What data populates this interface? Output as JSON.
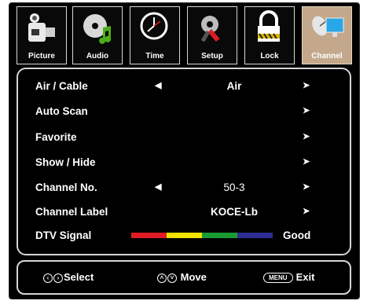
{
  "tabs": [
    {
      "label": "Picture",
      "icon": "camcorder-icon"
    },
    {
      "label": "Audio",
      "icon": "music-disc-icon"
    },
    {
      "label": "Time",
      "icon": "clock-icon"
    },
    {
      "label": "Setup",
      "icon": "tools-icon"
    },
    {
      "label": "Lock",
      "icon": "padlock-icon"
    },
    {
      "label": "Channel",
      "icon": "satellite-dish-icon",
      "active": true
    }
  ],
  "menu": {
    "items": [
      {
        "label": "Air / Cable",
        "value": "Air",
        "left_arrow": "◀",
        "right_arrow": "➤"
      },
      {
        "label": "Auto Scan",
        "right_arrow": "➤"
      },
      {
        "label": "Favorite",
        "right_arrow": "➤"
      },
      {
        "label": "Show / Hide",
        "right_arrow": "➤"
      },
      {
        "label": "Channel No.",
        "value": "50-3",
        "left_arrow": "◀",
        "right_arrow": "➤"
      },
      {
        "label": "Channel Label",
        "value": "KOCE-Lb",
        "right_arrow": "➤"
      },
      {
        "label": "DTV Signal",
        "value": "Good"
      }
    ],
    "signal_colors": [
      "#e01b24",
      "#f5e400",
      "#1a9a33",
      "#2c2d92"
    ]
  },
  "footer": {
    "select_label": "Select",
    "move_label": "Move",
    "menu_key": "MENU",
    "exit_label": "Exit"
  },
  "colors": {
    "active_tab": "#c3a88c",
    "background": "#000000",
    "border": "#d6d6d6"
  }
}
